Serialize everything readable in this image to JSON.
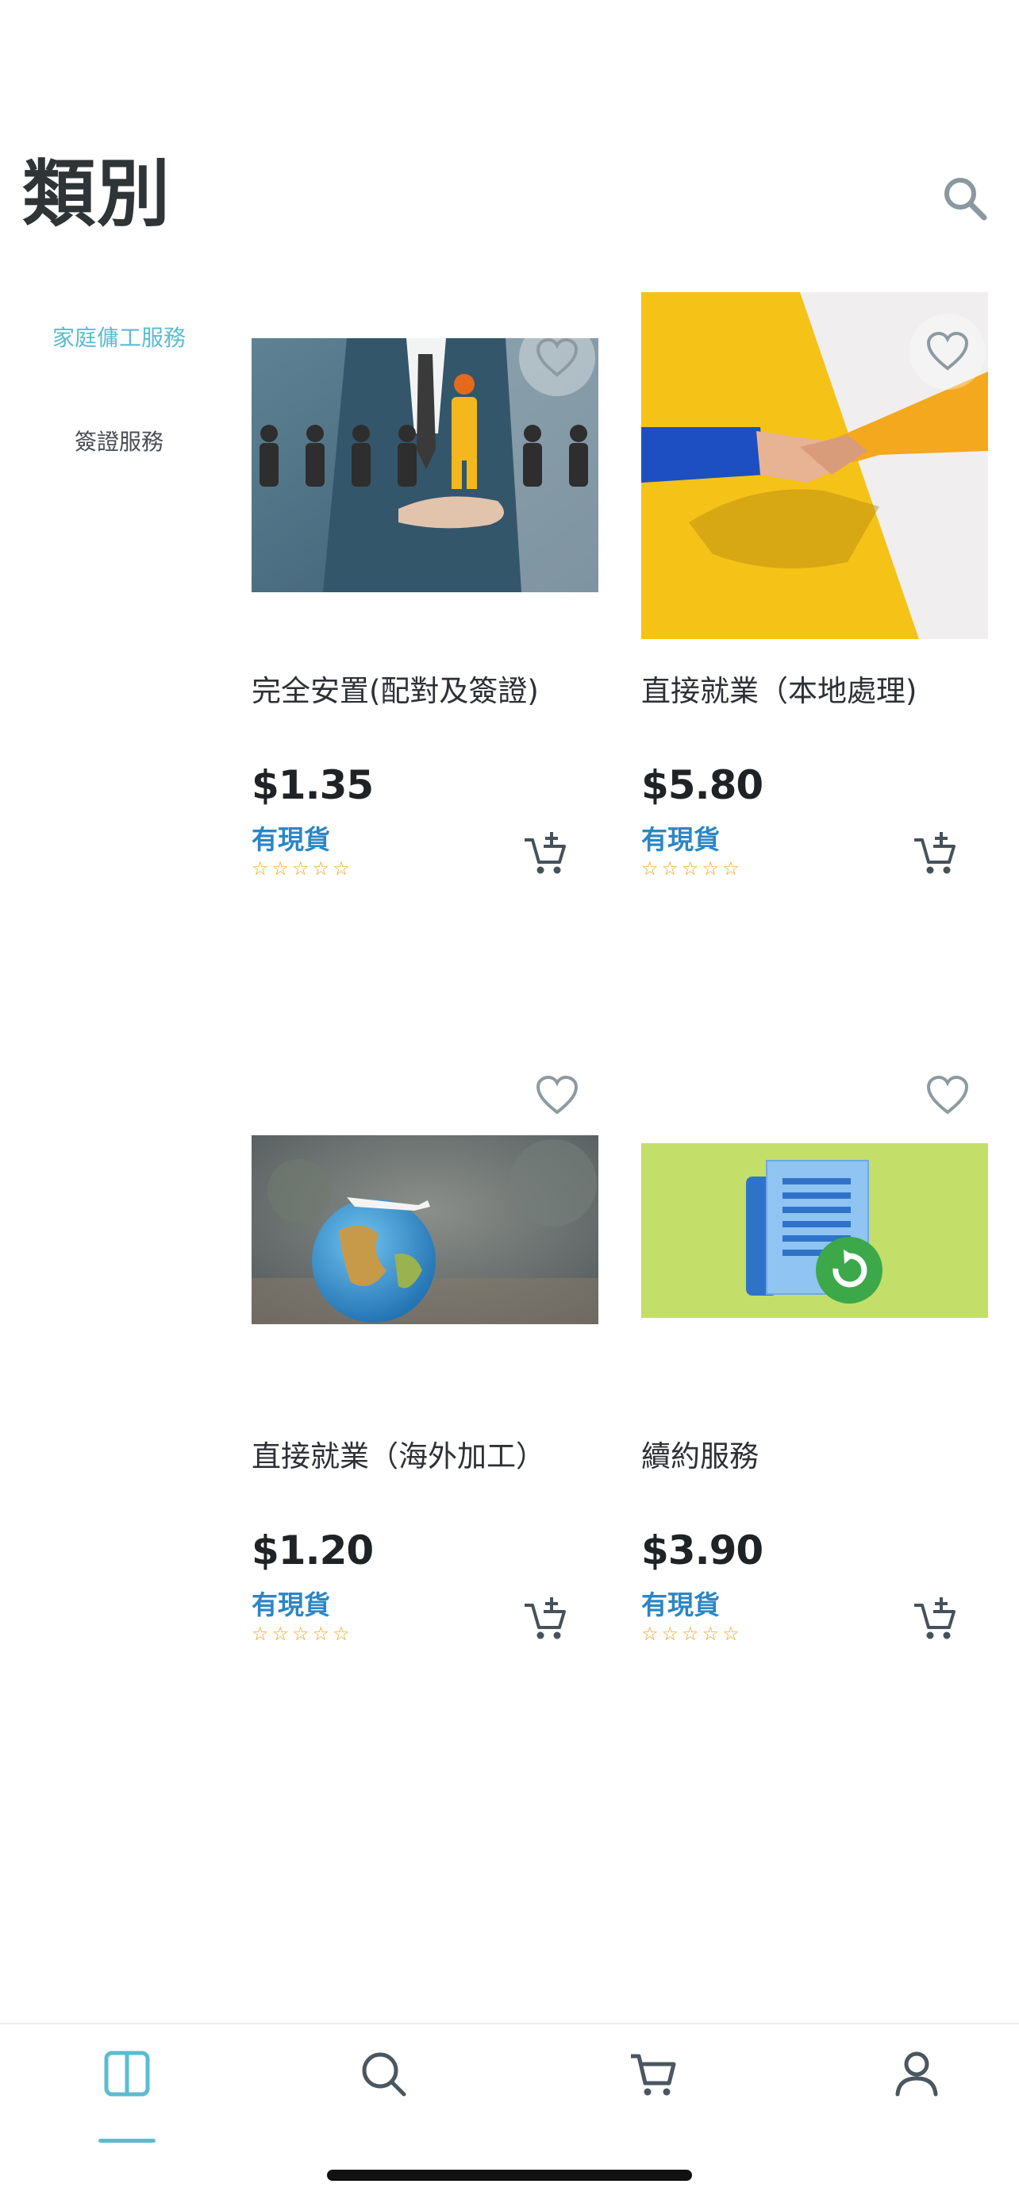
{
  "header": {
    "title": "類別"
  },
  "categories": [
    {
      "label": "家庭傭工服務",
      "active": true
    },
    {
      "label": "簽證服務",
      "active": false
    }
  ],
  "products": [
    {
      "name": "完全安置(配對及簽證)",
      "price": "$1.35",
      "stock": "有現貨",
      "rating": 0,
      "stars": "☆☆☆☆☆"
    },
    {
      "name": "直接就業（本地處理)",
      "price": "$5.80",
      "stock": "有現貨",
      "rating": 0,
      "stars": "☆☆☆☆☆"
    },
    {
      "name": "直接就業（海外加工）",
      "price": "$1.20",
      "stock": "有現貨",
      "rating": 0,
      "stars": "☆☆☆☆☆"
    },
    {
      "name": "續約服務",
      "price": "$3.90",
      "stock": "有現貨",
      "rating": 0,
      "stars": "☆☆☆☆☆"
    }
  ],
  "tabs": [
    {
      "icon": "categories-icon",
      "active": true
    },
    {
      "icon": "search-icon",
      "active": false
    },
    {
      "icon": "cart-icon",
      "active": false
    },
    {
      "icon": "profile-icon",
      "active": false
    }
  ],
  "colors": {
    "accent": "#5bbcd0",
    "stock": "#2b86c5",
    "stars": "#f0a21b",
    "icon": "#6b7d86"
  }
}
